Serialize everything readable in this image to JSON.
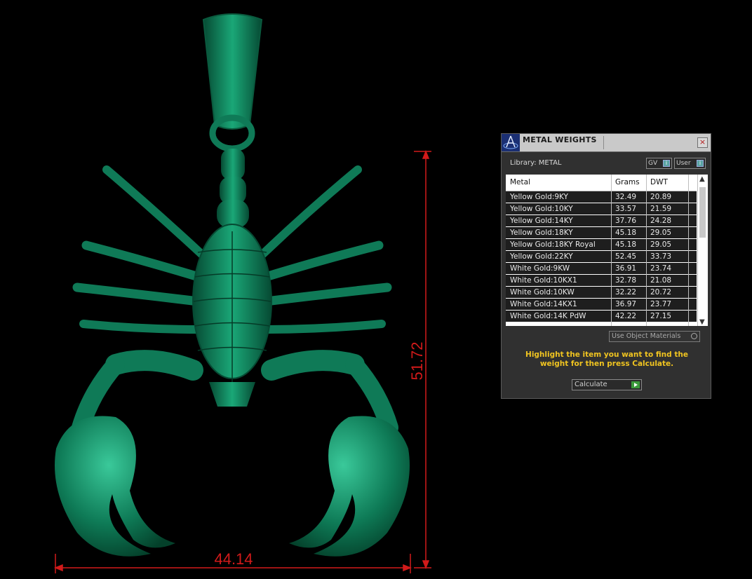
{
  "viewport": {
    "model_color": "#0f7a57",
    "dimension_color": "#d21a1a",
    "dimension_width": "44.14",
    "dimension_height": "51.72"
  },
  "panel": {
    "title": "METAL WEIGHTS",
    "close_label": "×",
    "library_label": "Library: METAL",
    "gv_label": "GV",
    "user_label": "User",
    "columns": {
      "metal": "Metal",
      "grams": "Grams",
      "dwt": "DWT"
    },
    "rows": [
      {
        "metal": "Yellow Gold:9KY",
        "grams": "32.49",
        "dwt": "20.89"
      },
      {
        "metal": "Yellow Gold:10KY",
        "grams": "33.57",
        "dwt": "21.59"
      },
      {
        "metal": "Yellow Gold:14KY",
        "grams": "37.76",
        "dwt": "24.28"
      },
      {
        "metal": "Yellow Gold:18KY",
        "grams": "45.18",
        "dwt": "29.05"
      },
      {
        "metal": "Yellow Gold:18KY Royal",
        "grams": "45.18",
        "dwt": "29.05"
      },
      {
        "metal": "Yellow Gold:22KY",
        "grams": "52.45",
        "dwt": "33.73"
      },
      {
        "metal": "White Gold:9KW",
        "grams": "36.91",
        "dwt": "23.74"
      },
      {
        "metal": "White Gold:10KX1",
        "grams": "32.78",
        "dwt": "21.08"
      },
      {
        "metal": "White Gold:10KW",
        "grams": "32.22",
        "dwt": "20.72"
      },
      {
        "metal": "White Gold:14KX1",
        "grams": "36.97",
        "dwt": "23.77"
      },
      {
        "metal": "White Gold:14K PdW",
        "grams": "42.22",
        "dwt": "27.15"
      }
    ],
    "use_object_materials_label": "Use Object Materials",
    "hint": "Highlight the item you want to find the weight for then press Calculate.",
    "calculate_label": "Calculate",
    "accent_color": "#f0c420"
  }
}
